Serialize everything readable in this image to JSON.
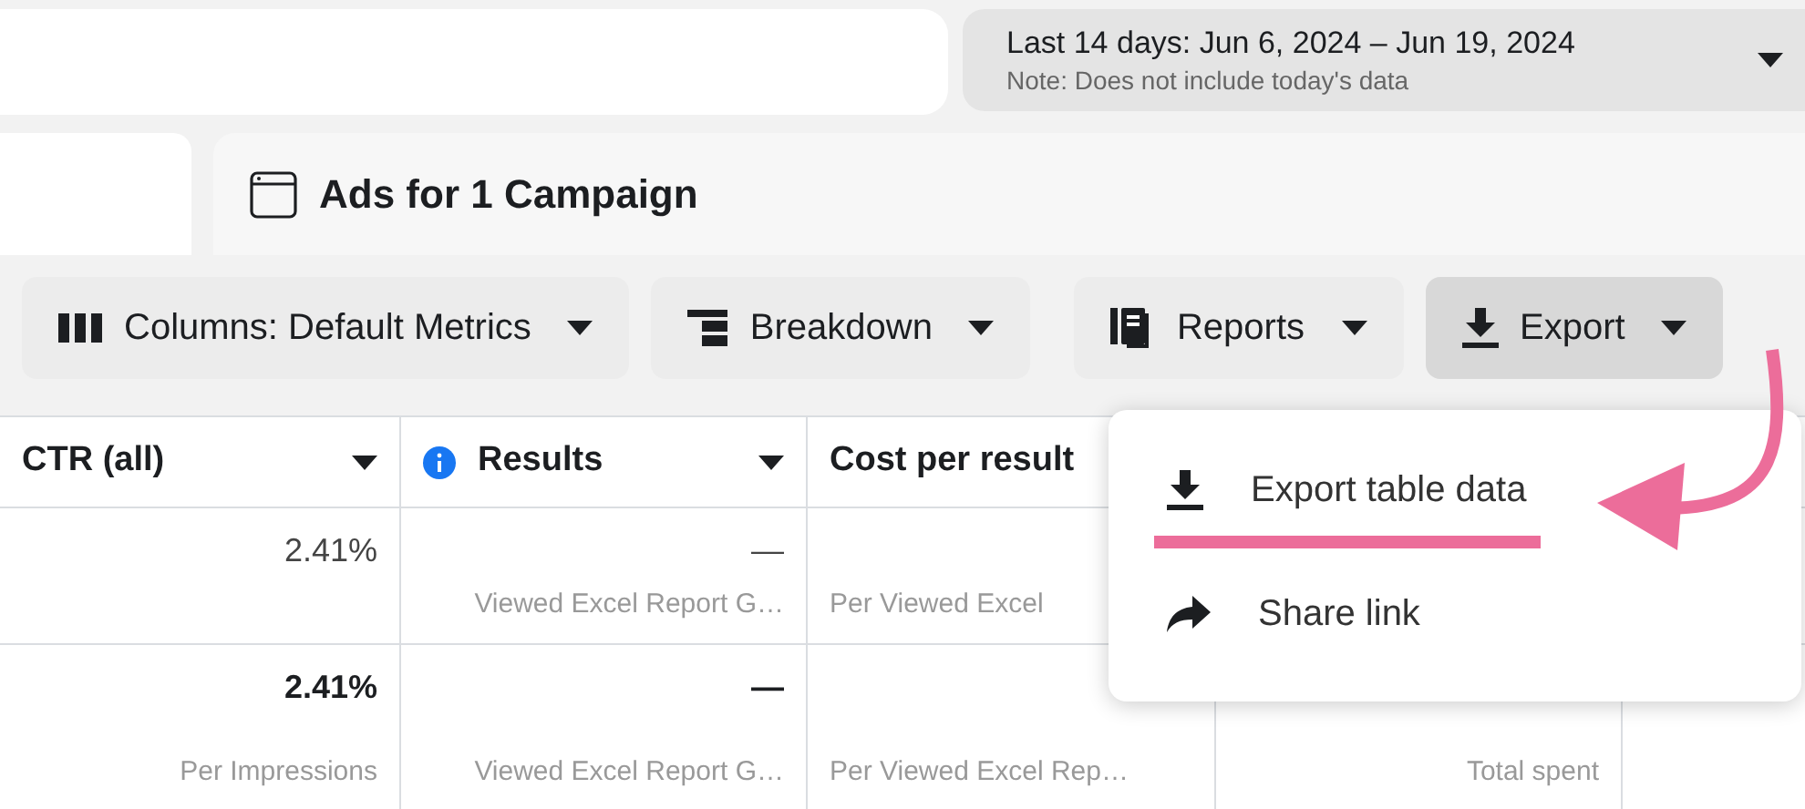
{
  "date_range": {
    "label": "Last 14 days: Jun 6, 2024 – Jun 19, 2024",
    "note": "Note: Does not include today's data"
  },
  "tab": {
    "title": "Ads for 1 Campaign"
  },
  "toolbar": [
    {
      "kind": "columns",
      "label": "Columns: Default Metrics",
      "pressed": false
    },
    {
      "kind": "breakdown",
      "label": "Breakdown",
      "pressed": false
    },
    {
      "kind": "reports",
      "label": "Reports",
      "pressed": false
    },
    {
      "kind": "export",
      "label": "Export",
      "pressed": true
    }
  ],
  "table": {
    "columns": [
      {
        "label": "CTR (all)",
        "info": false,
        "sortable": true
      },
      {
        "label": "Results",
        "info": true,
        "sortable": true
      },
      {
        "label": "Cost per result",
        "info": false
      }
    ],
    "rows": [
      [
        {
          "value": "2.41%",
          "bold": false
        },
        {
          "value": "—",
          "sub": "Viewed Excel Report G…",
          "bold": false
        },
        {
          "sub": "Per Viewed Excel"
        },
        {}
      ],
      [
        {
          "value": "2.41%",
          "sub": "Per Impressions",
          "bold": true
        },
        {
          "value": "—",
          "sub": "Viewed Excel Report G…",
          "bold": true
        },
        {
          "sub": "Per Viewed Excel Rep…"
        },
        {
          "sub": "Total spent"
        }
      ]
    ]
  },
  "export_menu": {
    "items": [
      {
        "kind": "download",
        "label": "Export table data",
        "highlighted": true
      },
      {
        "kind": "share",
        "label": "Share link",
        "highlighted": false
      }
    ]
  }
}
